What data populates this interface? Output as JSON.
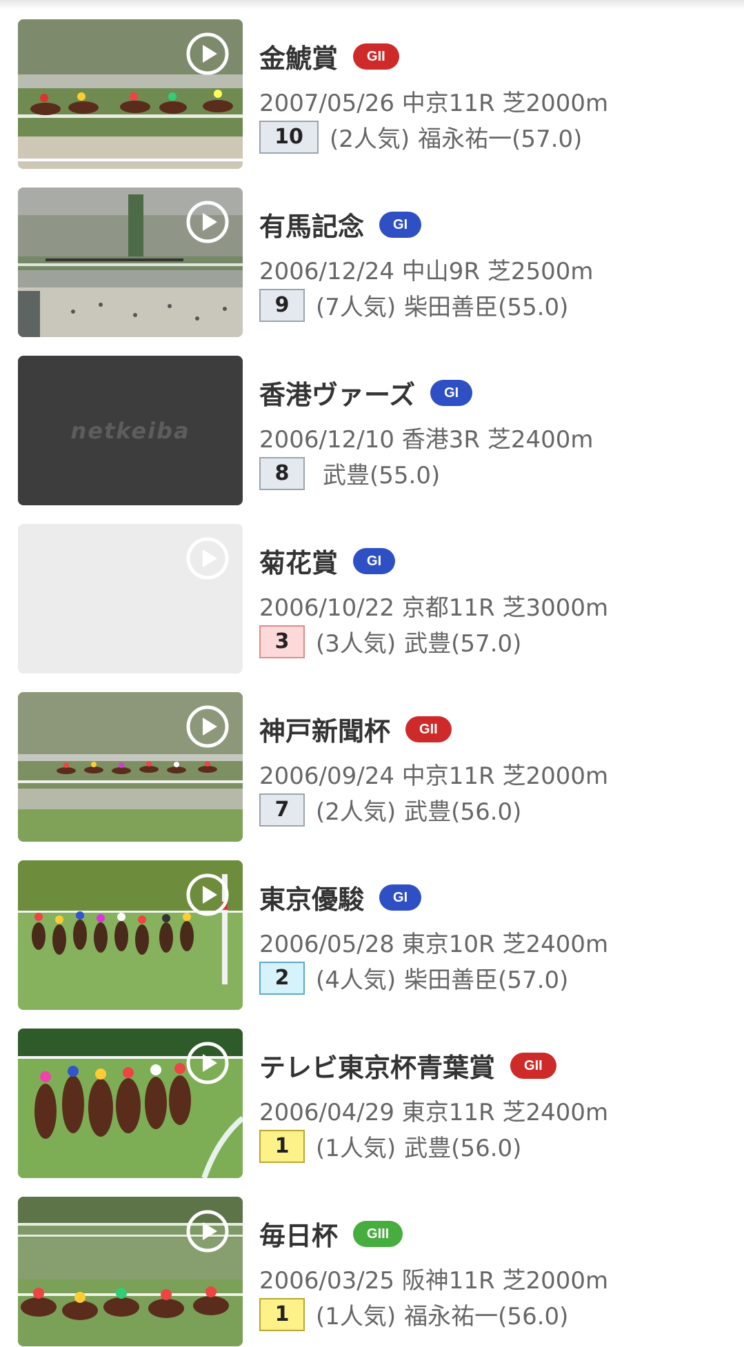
{
  "colors": {
    "grade_g1": "#2f4fc4",
    "grade_g2": "#cf2a2a",
    "grade_g3": "#46ad3e",
    "rank_default_bg": "#e4e9ef",
    "rank_third_bg": "#fdd9d9",
    "rank_second_bg": "#d6f2fb",
    "rank_first_bg": "#fdf18a"
  },
  "races": [
    {
      "name": "金鯱賞",
      "grade": "GII",
      "grade_class": "g2",
      "date": "2007/05/26",
      "venue": "中京11R",
      "course": "芝2000m",
      "rank": "10",
      "popularity": "(2人気)",
      "jockey": "福永祐一(57.0)",
      "thumb": "video",
      "icon": "play-icon"
    },
    {
      "name": "有馬記念",
      "grade": "GI",
      "grade_class": "g1",
      "date": "2006/12/24",
      "venue": "中山9R",
      "course": "芝2500m",
      "rank": "9",
      "popularity": "(7人気)",
      "jockey": "柴田善臣(55.0)",
      "thumb": "video",
      "icon": "play-icon"
    },
    {
      "name": "香港ヴァーズ",
      "grade": "GI",
      "grade_class": "g1",
      "date": "2006/12/10",
      "venue": "香港3R",
      "course": "芝2400m",
      "rank": "8",
      "popularity": "",
      "jockey": "武豊(55.0)",
      "thumb": "logo",
      "logo_text": "netkeiba"
    },
    {
      "name": "菊花賞",
      "grade": "GI",
      "grade_class": "g1",
      "date": "2006/10/22",
      "venue": "京都11R",
      "course": "芝3000m",
      "rank": "3",
      "popularity": "(3人気)",
      "jockey": "武豊(57.0)",
      "thumb": "blank",
      "icon": "play-icon"
    },
    {
      "name": "神戸新聞杯",
      "grade": "GII",
      "grade_class": "g2",
      "date": "2006/09/24",
      "venue": "中京11R",
      "course": "芝2000m",
      "rank": "7",
      "popularity": "(2人気)",
      "jockey": "武豊(56.0)",
      "thumb": "video",
      "icon": "play-icon"
    },
    {
      "name": "東京優駿",
      "grade": "GI",
      "grade_class": "g1",
      "date": "2006/05/28",
      "venue": "東京10R",
      "course": "芝2400m",
      "rank": "2",
      "popularity": "(4人気)",
      "jockey": "柴田善臣(57.0)",
      "thumb": "video",
      "icon": "play-icon"
    },
    {
      "name": "テレビ東京杯青葉賞",
      "grade": "GII",
      "grade_class": "g2",
      "date": "2006/04/29",
      "venue": "東京11R",
      "course": "芝2400m",
      "rank": "1",
      "popularity": "(1人気)",
      "jockey": "武豊(56.0)",
      "thumb": "video",
      "icon": "play-icon"
    },
    {
      "name": "毎日杯",
      "grade": "GIII",
      "grade_class": "g3",
      "date": "2006/03/25",
      "venue": "阪神11R",
      "course": "芝2000m",
      "rank": "1",
      "popularity": "(1人気)",
      "jockey": "福永祐一(56.0)",
      "thumb": "video",
      "icon": "play-icon"
    }
  ]
}
